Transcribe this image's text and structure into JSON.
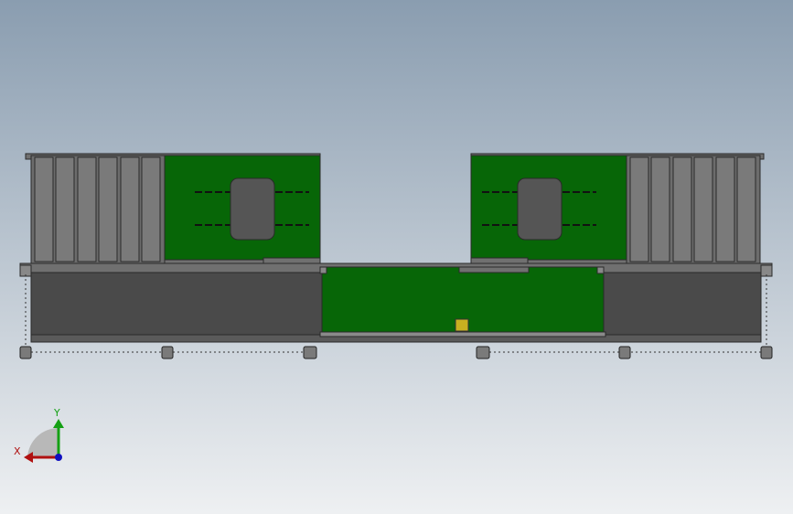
{
  "viewport": {
    "background_top": "#8a9db0",
    "background_bottom": "#eef0f2"
  },
  "model": {
    "frame_color": "#707070",
    "frame_edge": "#2a2a2a",
    "panel_dark": "#4a4a4a",
    "panel_mid": "#5a5a5a",
    "pcb_green": "#076607",
    "chip_color": "#555555"
  },
  "triad": {
    "x_label": "X",
    "y_label": "Y",
    "x_color": "#b01010",
    "y_color": "#14a014",
    "z_color": "#1010c0"
  }
}
